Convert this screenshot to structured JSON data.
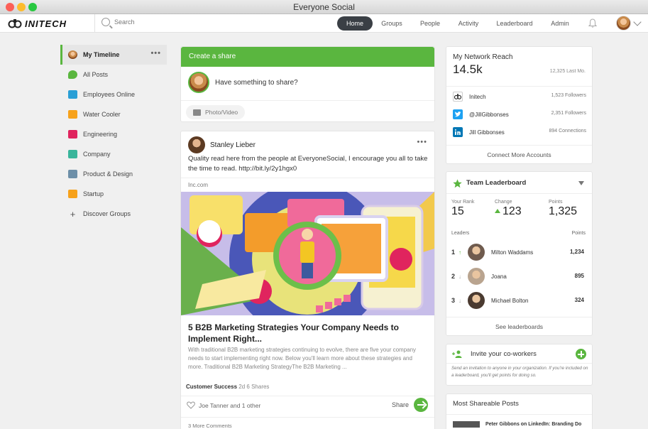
{
  "window": {
    "title": "Everyone Social"
  },
  "brand": {
    "name": "INITECH"
  },
  "search": {
    "placeholder": "Search"
  },
  "nav": {
    "items": [
      "Home",
      "Groups",
      "People",
      "Activity",
      "Leaderboard",
      "Admin"
    ],
    "active": "Home"
  },
  "sidebar": {
    "items": [
      {
        "label": "My Timeline",
        "icon": "avatar-icon",
        "active": true
      },
      {
        "label": "All Posts",
        "icon": "chat-bubble-icon",
        "color": "#5ab63f"
      },
      {
        "label": "Employees Online",
        "icon": "group-image-icon",
        "color": "#2a9fd6"
      },
      {
        "label": "Water Cooler",
        "icon": "group-image-icon",
        "color": "#f7a21b"
      },
      {
        "label": "Engineering",
        "icon": "group-image-icon",
        "color": "#e0245e"
      },
      {
        "label": "Company",
        "icon": "group-image-icon",
        "color": "#39b59b"
      },
      {
        "label": "Product & Design",
        "icon": "group-image-icon",
        "color": "#6d8fa8"
      },
      {
        "label": "Startup",
        "icon": "group-image-icon",
        "color": "#f7a21b"
      }
    ],
    "discover": "Discover Groups"
  },
  "create_share": {
    "header": "Create a share",
    "prompt": "Have something to share?",
    "photo_button": "Photo/Video"
  },
  "post": {
    "author": "Stanley Lieber",
    "text": "Quality read here from the people at EveryoneSocial, I encourage you all to take the time to read. http://bit.ly/2y1hgx0",
    "domain": "Inc.com",
    "article_title": "5 B2B Marketing Strategies Your Company Needs to Implement Right...",
    "article_desc": "With traditional B2B marketing strategies continuing to evolve, there are five your company needs to start implementing right now. Below you'll learn more about these strategies and more. Traditional B2B Marketing StrategyThe B2B Marketing ...",
    "group": "Customer Success",
    "age": "2d",
    "shares": "6 Shares",
    "likes": "Joe Tanner and 1 other",
    "share_label": "Share",
    "more_comments": "3 More Comments"
  },
  "network_reach": {
    "title": "My Network Reach",
    "value": "14.5k",
    "last_month": "12,325 Last Mo.",
    "accounts": [
      {
        "name": "Initech",
        "stat": "1,523 Followers",
        "icon": "initech-icon"
      },
      {
        "name": "@JillGibbonses",
        "stat": "2,351 Followers",
        "icon": "twitter-icon",
        "color": "#1da1f2"
      },
      {
        "name": "Jill Gibbonses",
        "stat": "894 Connections",
        "icon": "linkedin-icon",
        "color": "#0077b5"
      }
    ],
    "connect_more": "Connect More Accounts"
  },
  "leaderboard": {
    "title": "Team Leaderboard",
    "rank_label": "Your Rank",
    "rank": "15",
    "change_label": "Change",
    "change": "123",
    "points_label": "Points",
    "points": "1,325",
    "leaders_label": "Leaders",
    "points_col": "Points",
    "leaders": [
      {
        "rank": "1",
        "trend": "up",
        "name": "Milton Waddams",
        "points": "1,234"
      },
      {
        "rank": "2",
        "trend": "down",
        "name": "Joana",
        "points": "895"
      },
      {
        "rank": "3",
        "trend": "down",
        "name": "Michael Bolton",
        "points": "324"
      }
    ],
    "see_all": "See leaderboards"
  },
  "invite": {
    "title": "Invite your co-workers",
    "text": "Send an invitation to anyone in your organization. If you're included on a leaderboard, you'll get points for doing so."
  },
  "shareable": {
    "title": "Most Shareable Posts",
    "first_item": "Peter Gibbons on LinkedIn: Branding Do"
  },
  "colors": {
    "accent": "#5ab63f",
    "nav_active": "#3a3f45"
  }
}
